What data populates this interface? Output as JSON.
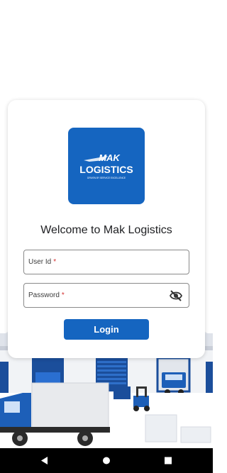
{
  "logo": {
    "name_line1": "MAK",
    "name_line2": "LOGISTICS",
    "tagline": "DRIVEN BY SERVICE EXCELLENCE"
  },
  "welcome_text": "Welcome to Mak Logistics",
  "form": {
    "user_id_label": "User Id",
    "password_label": "Password",
    "required_marker": "*",
    "login_label": "Login"
  },
  "icons": {
    "password_toggle": "eye-off-icon",
    "nav_back": "back-triangle-icon",
    "nav_home": "home-circle-icon",
    "nav_recents": "recents-square-icon"
  },
  "colors": {
    "brand": "#1565c0",
    "required": "#d32f2f"
  }
}
